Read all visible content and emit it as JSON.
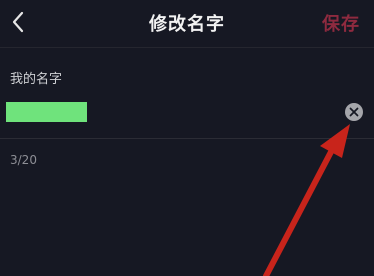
{
  "header": {
    "title": "修改名字",
    "save_label": "保存"
  },
  "form": {
    "label": "我的名字",
    "char_count": "3/20"
  },
  "colors": {
    "background": "#161823",
    "save_accent": "#8e2a3f",
    "annotation_arrow": "#c8241b",
    "redaction_box": "#6fe37c"
  },
  "icons": {
    "back": "chevron-left-icon",
    "clear": "close-circle-icon"
  }
}
